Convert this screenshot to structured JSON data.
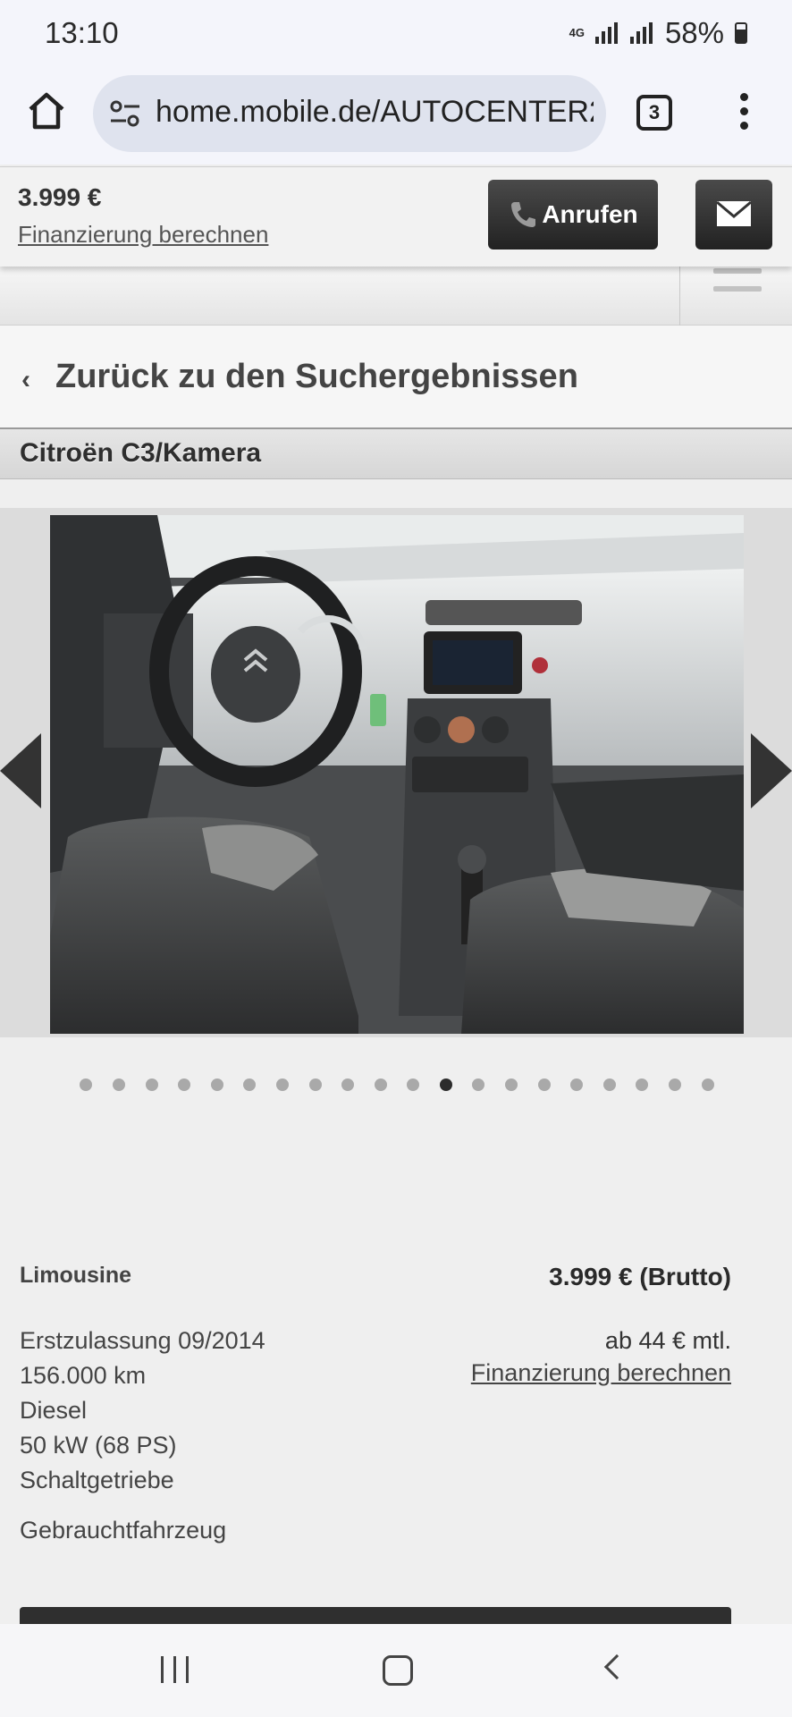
{
  "status_bar": {
    "time": "13:10",
    "network": "4G",
    "battery": "58%"
  },
  "browser": {
    "url": "home.mobile.de/AUTOCENTER2",
    "tab_count": "3"
  },
  "sticky_bar": {
    "price": "3.999 €",
    "finance_link": "Finanzierung berechnen",
    "call_label": "Anrufen",
    "call_icon": "phone-icon",
    "mail_icon": "mail-icon"
  },
  "nav": {
    "back_label": "Zurück zu den Suchergebnissen"
  },
  "listing": {
    "title": "Citroën C3/Kamera",
    "gallery": {
      "total_images": 20,
      "active_index": 11
    },
    "body_type": "Limousine",
    "price_gross": "3.999 € (Brutto)",
    "monthly": "ab 44 € mtl.",
    "finance_link": "Finanzierung berechnen",
    "first_registration": "Erstzulassung 09/2014",
    "mileage": "156.000 km",
    "fuel": "Diesel",
    "power": "50 kW (68 PS)",
    "transmission": "Schaltgetriebe",
    "condition": "Gebrauchtfahrzeug"
  }
}
